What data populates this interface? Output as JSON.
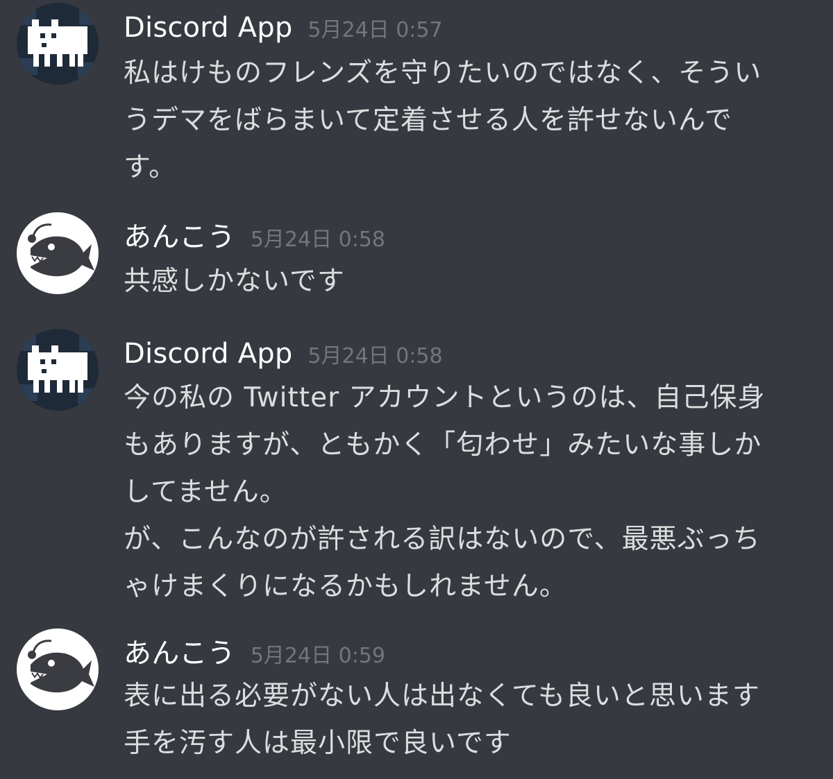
{
  "messages": [
    {
      "author": "Discord App",
      "avatar_icon": "pixel-creature-icon",
      "timestamp": "5月24日 0:57",
      "lines": [
        "私はけものフレンズを守りたいのではなく、そうい",
        "うデマをばらまいて定着させる人を許せないんで",
        "す。"
      ]
    },
    {
      "author": "あんこう",
      "avatar_icon": "anglerfish-icon",
      "timestamp": "5月24日 0:58",
      "lines": [
        "共感しかないです"
      ]
    },
    {
      "author": "Discord App",
      "avatar_icon": "pixel-creature-icon",
      "timestamp": "5月24日 0:58",
      "lines": [
        "今の私の Twitter アカウントというのは、自己保身",
        "もありますが、ともかく「匂わせ」みたいな事しか",
        "してません。",
        "が、こんなのが許される訳はないので、最悪ぶっち",
        "ゃけまくりになるかもしれません。"
      ]
    },
    {
      "author": "あんこう",
      "avatar_icon": "anglerfish-icon",
      "timestamp": "5月24日 0:59",
      "lines": [
        "表に出る必要がない人は出なくても良いと思います",
        "手を汚す人は最小限で良いです"
      ]
    }
  ],
  "colors": {
    "background": "#36393f",
    "username": "#ffffff",
    "timestamp": "#72767d",
    "message_text": "#dcddde"
  }
}
